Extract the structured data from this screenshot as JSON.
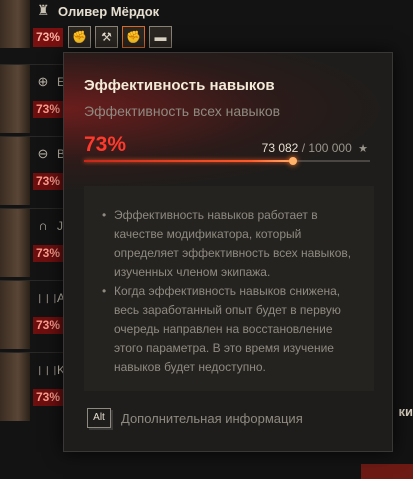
{
  "header": {
    "role_icon": "commander-icon",
    "name": "Оливер Мёрдок",
    "efficiency": "73%",
    "skills": [
      {
        "icon": "fist-icon",
        "symbol": "✊"
      },
      {
        "icon": "tools-icon",
        "symbol": "⚒"
      },
      {
        "icon": "skill-fist-icon",
        "symbol": "✊"
      },
      {
        "icon": "tank-icon",
        "symbol": "▬"
      }
    ]
  },
  "crew": [
    {
      "role_icon": "crosshair-icon",
      "symbol": "⊕",
      "letter": "E",
      "efficiency": "73%"
    },
    {
      "role_icon": "steering-wheel-icon",
      "symbol": "⊖",
      "letter": "B",
      "efficiency": "73%"
    },
    {
      "role_icon": "headphones-icon",
      "symbol": "∩",
      "letter": "J",
      "efficiency": "73%"
    },
    {
      "role_icon": "ammo-icon",
      "symbol": "❘❘❘",
      "letter": "A",
      "efficiency": "73%"
    },
    {
      "role_icon": "ammo-icon",
      "symbol": "❘❘❘",
      "letter": "K",
      "efficiency": "73%"
    }
  ],
  "right_label": "ки",
  "tooltip": {
    "title": "Эффективность навыков",
    "subtitle": "Эффективность всех навыков",
    "percent": "73%",
    "progress": 0.73,
    "xp_current": "73 082",
    "xp_separator": "/",
    "xp_max": "100 000",
    "xp_icon": "star-icon",
    "bullets": [
      "Эффективность навыков работает в качестве модификатора, который определяет эффективность всех навыков, изученных членом экипажа.",
      "Когда эффективность навыков снижена, весь заработанный опыт будет в первую очередь направлен на восстановление этого параметра. В это время изучение навыков будет недоступно."
    ],
    "alt_key": "Alt",
    "footer_text": "Дополнительная информация"
  },
  "colors": {
    "accent_red": "#ff3a2c",
    "badge_red": "#7a1010",
    "panel_bg": "#1e1d1b"
  }
}
